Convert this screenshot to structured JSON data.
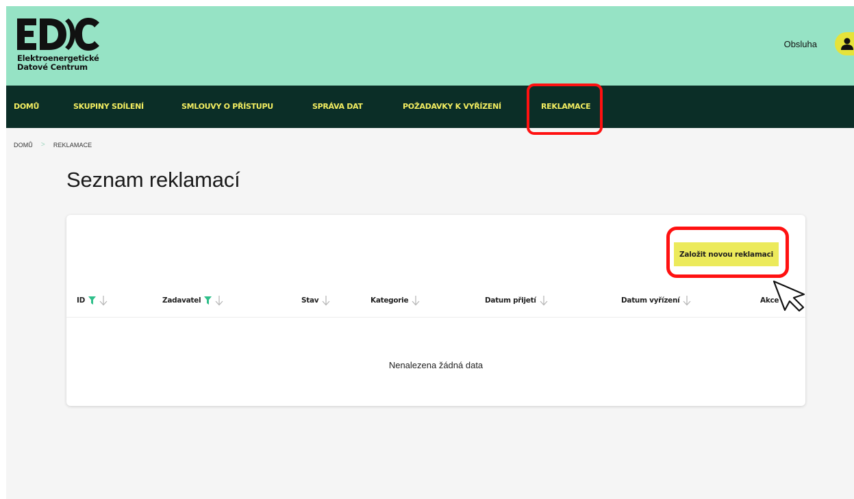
{
  "header": {
    "logo_line1": "Elektroenergetické",
    "logo_line2": "Datové Centrum",
    "logo_wordmark": "EDC",
    "user_name": "Obsluha",
    "brand_color": "#96e3c5",
    "accent_color": "#ecea5b"
  },
  "nav": {
    "items": [
      {
        "label": "DOMŮ"
      },
      {
        "label": "SKUPINY SDÍLENÍ"
      },
      {
        "label": "SMLOUVY O PŘÍSTUPU"
      },
      {
        "label": "SPRÁVA DAT"
      },
      {
        "label": "POŽADAVKY K VYŘÍZENÍ"
      },
      {
        "label": "REKLAMACE"
      }
    ],
    "active": "REKLAMACE",
    "background": "#0b2e27"
  },
  "breadcrumb": {
    "items": [
      {
        "label": "DOMŮ"
      },
      {
        "label": "REKLAMACE"
      }
    ],
    "separator": ">"
  },
  "page": {
    "title": "Seznam reklamací"
  },
  "table": {
    "new_button_label": "Založit novou reklamaci",
    "columns": [
      {
        "label": "ID",
        "filter": true,
        "sort": true
      },
      {
        "label": "Zadavatel",
        "filter": true,
        "sort": true
      },
      {
        "label": "Stav",
        "filter": false,
        "sort": true
      },
      {
        "label": "Kategorie",
        "filter": false,
        "sort": true
      },
      {
        "label": "Datum přijetí",
        "filter": false,
        "sort": true
      },
      {
        "label": "Datum vyřízení",
        "filter": false,
        "sort": true
      },
      {
        "label": "Akce",
        "filter": false,
        "sort": false
      }
    ],
    "rows": [],
    "empty_message": "Nenalezena žádná data"
  },
  "icons": {
    "filter": "funnel-icon",
    "sort": "arrow-down-icon",
    "user": "user-icon",
    "cursor": "mouse-pointer-icon"
  },
  "annotation_color": "#ff1111"
}
